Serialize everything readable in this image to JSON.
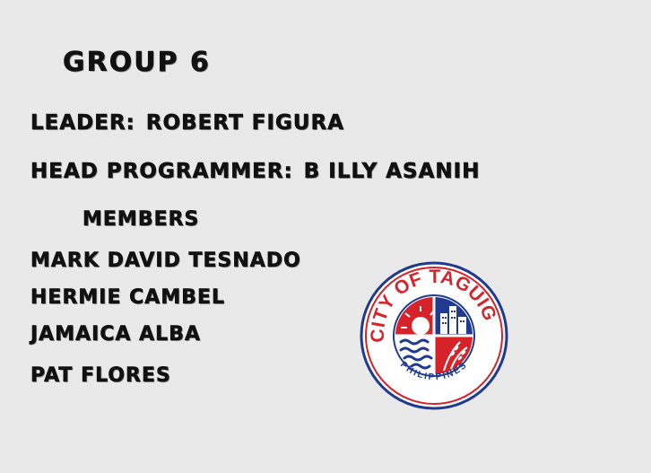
{
  "title": "GROUP 6",
  "leader": {
    "label": "LEADER:",
    "name": "ROBERT FIGURA"
  },
  "head_programmer": {
    "label": "HEAD PROGRAMMER:",
    "name": "B ILLY ASANIH"
  },
  "members_heading": "MEMBERS",
  "members": [
    "MARK DAVID TESNADO",
    "HERMIE CAMBEL",
    "JAMAICA ALBA",
    "PAT FLORES"
  ],
  "seal": {
    "text_top": "CITY OF TAGUIG",
    "text_bottom": "PHILIPPINES",
    "colors": {
      "navy": "#1f3a8f",
      "red": "#d6232a",
      "white": "#ffffff"
    }
  }
}
